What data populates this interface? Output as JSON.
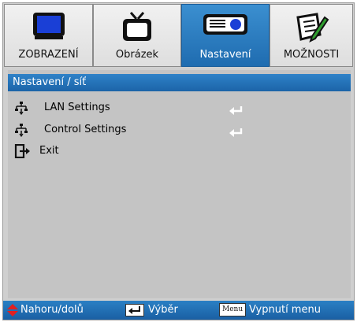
{
  "tabs": [
    {
      "label": "ZOBRAZENÍ",
      "icon": "monitor-icon",
      "active": false
    },
    {
      "label": "Obrázek",
      "icon": "tv-icon",
      "active": false
    },
    {
      "label": "Nastavení",
      "icon": "projector-icon",
      "active": true
    },
    {
      "label": "MOŽNOSTI",
      "icon": "notepad-pencil-icon",
      "active": false
    }
  ],
  "breadcrumb": "Nastavení / síť",
  "menu_items": [
    {
      "label": "LAN Settings",
      "icon": "network-icon",
      "action": "enter-icon"
    },
    {
      "label": "Control Settings",
      "icon": "network-icon",
      "action": "enter-icon"
    },
    {
      "label": "Exit",
      "icon": "exit-icon",
      "action": ""
    }
  ],
  "statusbar": {
    "navigate_label": "Nahoru/dolů",
    "select_label": "Výběr",
    "menu_key_label": "Menu",
    "exit_label": "Vypnutí menu"
  },
  "colors": {
    "accent": "#1f6cb0",
    "arrow": "#e02020"
  }
}
